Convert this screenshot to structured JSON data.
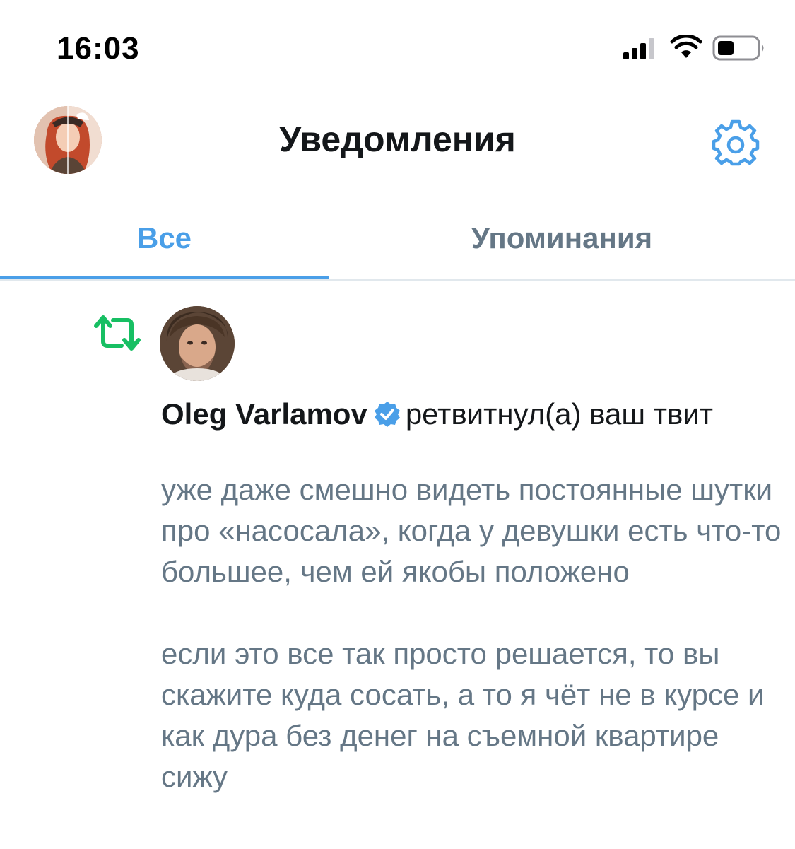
{
  "status_bar": {
    "time": "16:03",
    "icons": [
      "cellular-signal-icon",
      "wifi-icon",
      "battery-icon"
    ]
  },
  "header": {
    "title": "Уведомления",
    "avatar_icon": "profile-avatar",
    "settings_icon": "gear-icon"
  },
  "tabs": [
    {
      "label": "Все",
      "active": true
    },
    {
      "label": "Упоминания",
      "active": false
    }
  ],
  "colors": {
    "accent": "#4a9fe8",
    "retweet_green": "#17bf63",
    "secondary_text": "#657786"
  },
  "notification": {
    "type_icon": "retweet-icon",
    "actor_name": "Oleg Varlamov",
    "verified": true,
    "action_text": "ретвитнул(а) ваш твит",
    "tweet_paragraphs": [
      "уже даже смешно видеть постоянные шутки про «насосала», когда у девушки есть что-то большее, чем ей якобы положено",
      "если это все так просто решается, то вы скажите куда сосать, а то я чёт не в курсе и как дура без денег на съемной квартире сижу"
    ]
  }
}
